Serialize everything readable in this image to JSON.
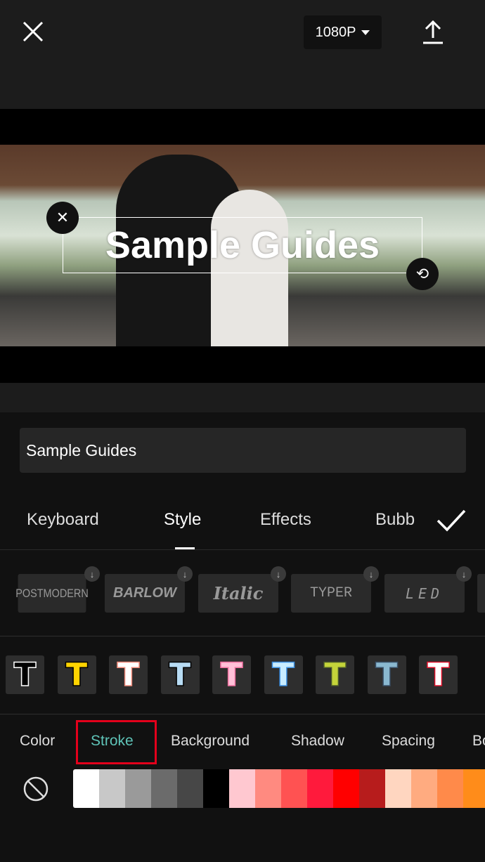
{
  "header": {
    "resolution": "1080P",
    "close_icon": "close-icon",
    "export_icon": "upload-icon"
  },
  "preview": {
    "overlay_text": "Sample Guides"
  },
  "text_input": {
    "value": "Sample Guides"
  },
  "tabs": [
    {
      "label": "Keyboard"
    },
    {
      "label": "Style",
      "active": true
    },
    {
      "label": "Effects"
    },
    {
      "label": "Bubb"
    }
  ],
  "fonts": [
    {
      "label": "POSTMODERN"
    },
    {
      "label": "BARLOW"
    },
    {
      "label": "Italic"
    },
    {
      "label": "TYPER"
    },
    {
      "label": "LED"
    }
  ],
  "presets": [
    {
      "fill": "#000000",
      "stroke": "#ffffff"
    },
    {
      "fill": "#ffd400",
      "stroke": "#000000"
    },
    {
      "fill": "#ffffff",
      "stroke": "#f08878"
    },
    {
      "fill": "#b8dcf4",
      "stroke": "#000000"
    },
    {
      "fill": "#ffc0d8",
      "stroke": "#f070a0"
    },
    {
      "fill": "#c8ecff",
      "stroke": "#3a8ee0"
    },
    {
      "fill": "#c4d43a",
      "stroke": "#4a5a2a"
    },
    {
      "fill": "#8ab8d0",
      "stroke": "#3a5068"
    },
    {
      "fill": "#ffffff",
      "stroke": "#e0102a"
    }
  ],
  "subtabs": [
    {
      "label": "Color"
    },
    {
      "label": "Stroke",
      "active": true
    },
    {
      "label": "Background"
    },
    {
      "label": "Shadow"
    },
    {
      "label": "Spacing"
    },
    {
      "label": "Bo"
    }
  ],
  "accent": "#5fc4b8",
  "swatches": [
    "#ffffff",
    "#c8c8c8",
    "#9a9a9a",
    "#6b6b6b",
    "#474747",
    "#000000",
    "#ffc8d0",
    "#ff8a80",
    "#ff5252",
    "#ff1a3c",
    "#ff0000",
    "#b71c1c",
    "#ffd6c0",
    "#ffab80",
    "#ff8a4a",
    "#ff8c1a"
  ]
}
